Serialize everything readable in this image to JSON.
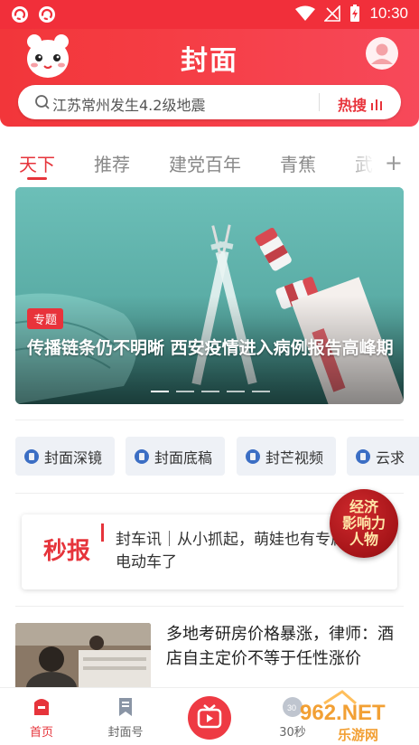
{
  "status_bar": {
    "time": "10:30"
  },
  "header": {
    "logo": "封面"
  },
  "search": {
    "placeholder": "江苏常州发生4.2级地震",
    "hot_label": "热搜"
  },
  "tabs": [
    {
      "label": "天下",
      "active": true
    },
    {
      "label": "推荐",
      "active": false
    },
    {
      "label": "建党百年",
      "active": false
    },
    {
      "label": "青蕉",
      "active": false
    },
    {
      "label": "武",
      "active": false
    }
  ],
  "banner": {
    "tag": "专题",
    "title": "传播链条仍不明晰 西安疫情进入病例报告高峰期",
    "slide_count": 5,
    "active_slide": 1
  },
  "channels": [
    {
      "label": "封面深镜"
    },
    {
      "label": "封面底稿"
    },
    {
      "label": "封芒视频"
    },
    {
      "label": "云求"
    }
  ],
  "promo": {
    "logo": "秒报",
    "text": "封车讯｜从小抓起，萌娃也有专属电动车了",
    "badge_line1": "经济",
    "badge_line2": "影响力",
    "badge_line3": "人物"
  },
  "news": [
    {
      "title": "多地考研房价格暴涨，律师：酒店自主定价不等于任性涨价"
    }
  ],
  "bottom_nav": [
    {
      "label": "首页",
      "active": true
    },
    {
      "label": "封面号",
      "active": false
    },
    {
      "label": "",
      "active": false
    },
    {
      "label": "30秒",
      "active": false
    }
  ],
  "watermark": {
    "text_top": "962.NET",
    "text_bottom": "乐游网"
  },
  "colors": {
    "brand_red": "#e6343b",
    "header_red": "#f2363a"
  }
}
